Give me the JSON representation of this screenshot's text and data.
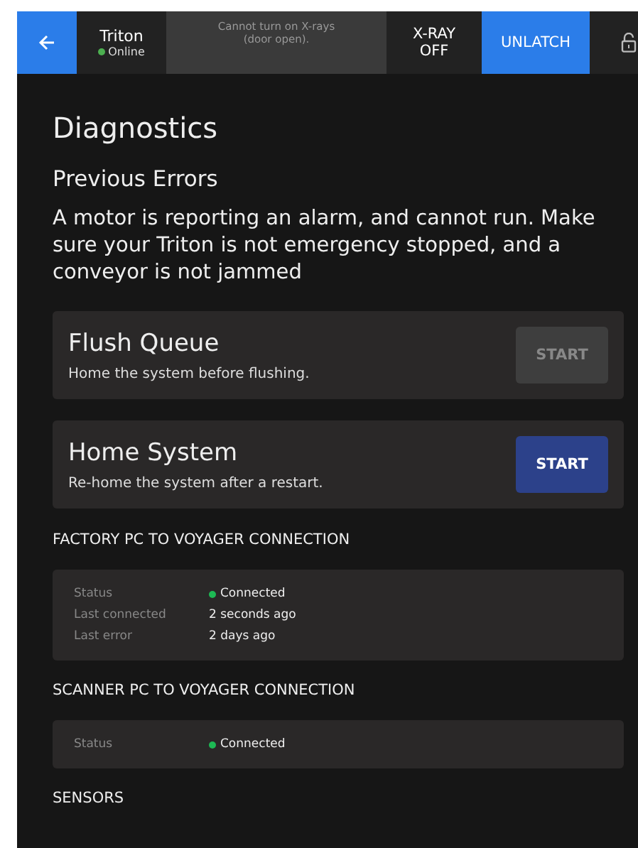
{
  "top_bar": {
    "device": {
      "name": "Triton",
      "status": "Online",
      "color": "#4caf50"
    },
    "message": "Cannot turn on X-rays\n(door open).",
    "xray": "X-RAY\nOFF",
    "unlatch": "UNLATCH"
  },
  "title": "Diagnostics",
  "subtitle": "Previous Errors",
  "error_text": "A motor is reporting an alarm, and cannot run. Make sure your Triton is not emergency stopped, and a conveyor is not jammed",
  "actions": [
    {
      "title": "Flush Queue",
      "description": "Home the system before flushing.",
      "button": "START",
      "disabled": true
    },
    {
      "title": "Home System",
      "description": "Re-home the system after a restart.",
      "button": "START",
      "disabled": false
    }
  ],
  "sections": [
    {
      "heading": "FACTORY PC TO VOYAGER CONNECTION",
      "rows": [
        {
          "label": "Status",
          "value": "Connected",
          "color": "#1db954"
        },
        {
          "label": "Last connected",
          "value": "2 seconds ago"
        },
        {
          "label": "Last error",
          "value": "2 days ago"
        }
      ]
    },
    {
      "heading": "SCANNER PC TO VOYAGER CONNECTION",
      "rows": [
        {
          "label": "Status",
          "value": "Connected",
          "color": "#1db954"
        }
      ]
    },
    {
      "heading": "SENSORS"
    }
  ]
}
